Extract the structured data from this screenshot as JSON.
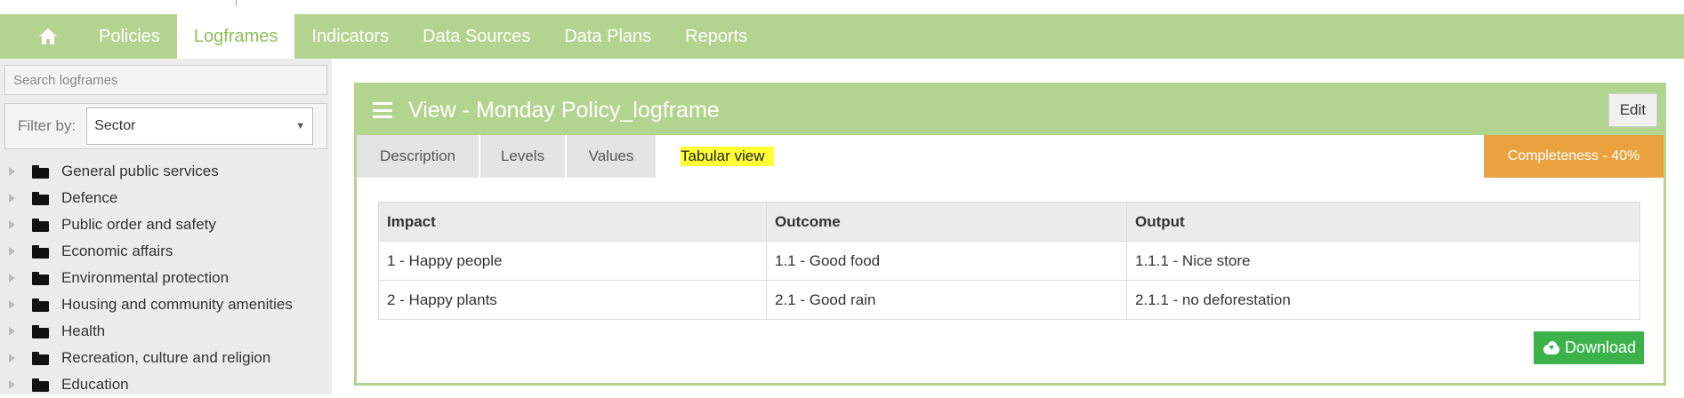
{
  "nav": {
    "home_icon": "home-icon",
    "items": [
      {
        "label": "Policies"
      },
      {
        "label": "Logframes",
        "active": true
      },
      {
        "label": "Indicators"
      },
      {
        "label": "Data Sources"
      },
      {
        "label": "Data Plans"
      },
      {
        "label": "Reports"
      }
    ]
  },
  "sidebar": {
    "search_placeholder": "Search logframes",
    "filter_label": "Filter by:",
    "filter_value": "Sector",
    "tree": [
      {
        "label": "General public services"
      },
      {
        "label": "Defence"
      },
      {
        "label": "Public order and safety"
      },
      {
        "label": "Economic affairs"
      },
      {
        "label": "Environmental protection"
      },
      {
        "label": "Housing and community amenities"
      },
      {
        "label": "Health"
      },
      {
        "label": "Recreation, culture and religion"
      },
      {
        "label": "Education"
      }
    ]
  },
  "panel": {
    "title": "View - Monday Policy_logframe",
    "edit_label": "Edit",
    "tabs": [
      {
        "label": "Description"
      },
      {
        "label": "Levels"
      },
      {
        "label": "Values"
      },
      {
        "label": "Tabular view",
        "active": true
      }
    ],
    "completeness": "Completeness - 40%",
    "table": {
      "headers": [
        "Impact",
        "Outcome",
        "Output"
      ],
      "rows": [
        [
          "1 - Happy people",
          "1.1 - Good food",
          "1.1.1 - Nice store"
        ],
        [
          "2 - Happy plants",
          "2.1 - Good rain",
          "2.1.1 - no deforestation"
        ]
      ]
    },
    "download_label": "Download"
  },
  "colors": {
    "navbar": "#b3d48f",
    "active_nav_text": "#8cbf5a",
    "completeness": "#eaa23e",
    "download": "#3cb34a",
    "highlight": "#ffff33"
  }
}
